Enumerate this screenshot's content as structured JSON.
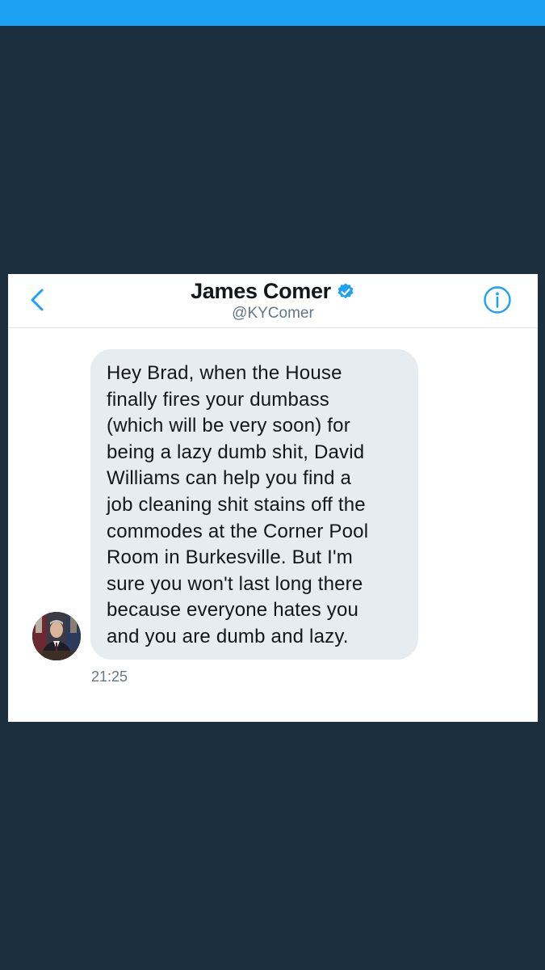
{
  "header": {
    "display_name": "James Comer",
    "handle": "@KYComer",
    "back_icon": "chevron-left-icon",
    "verified_icon": "verified-badge-icon",
    "info_icon": "info-icon"
  },
  "message": {
    "text": "Hey Brad, when the House finally fires your dumbass (which will be very soon) for being a lazy dumb shit, David Williams can help you find a job cleaning shit stains off the commodes at the Corner Pool Room in Burkesville. But I'm sure you won't last long there because everyone hates you and you are dumb and lazy.",
    "lines": [
      "Hey Brad, when the House",
      "finally fires your dumbass",
      "(which will be very soon) for",
      "being a lazy dumb shit, David",
      "Williams can help you find a",
      "job cleaning shit stains off the",
      "commodes at the Corner Pool",
      "Room in Burkesville. But I'm",
      "sure you won't last long there",
      "because everyone hates you",
      "and you are dumb and lazy."
    ],
    "timestamp": "21:25"
  },
  "colors": {
    "accent": "#1da1f2",
    "background": "#1b2f3f",
    "bubble": "#e6ecf0",
    "text": "#14171a",
    "muted": "#657786"
  }
}
